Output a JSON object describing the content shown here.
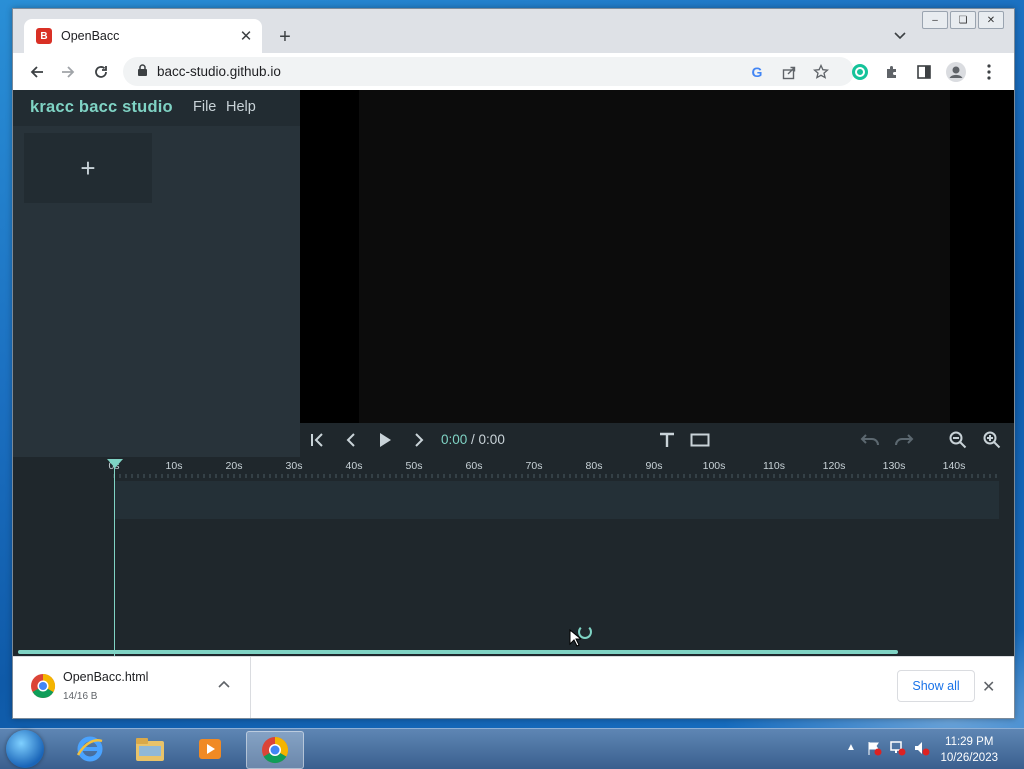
{
  "browser": {
    "tab_title": "OpenBacc",
    "favicon_letter": "B",
    "url": "bacc-studio.github.io"
  },
  "app": {
    "brand": "kracc bacc studio",
    "menu": [
      "File",
      "Help"
    ],
    "add_tile_symbol": "+",
    "time_current": "0:00",
    "time_separator": " / ",
    "time_total": "0:00",
    "accent_color": "#7fd3c4"
  },
  "timeline": {
    "ticks": [
      "0s",
      "10s",
      "20s",
      "30s",
      "40s",
      "50s",
      "60s",
      "70s",
      "80s",
      "90s",
      "100s",
      "110s",
      "120s",
      "130s",
      "140s"
    ]
  },
  "downloads": {
    "file_name": "OpenBacc.html",
    "status": "14/16 B",
    "show_all": "Show all"
  },
  "taskbar": {
    "time": "11:29 PM",
    "date": "10/26/2023"
  }
}
